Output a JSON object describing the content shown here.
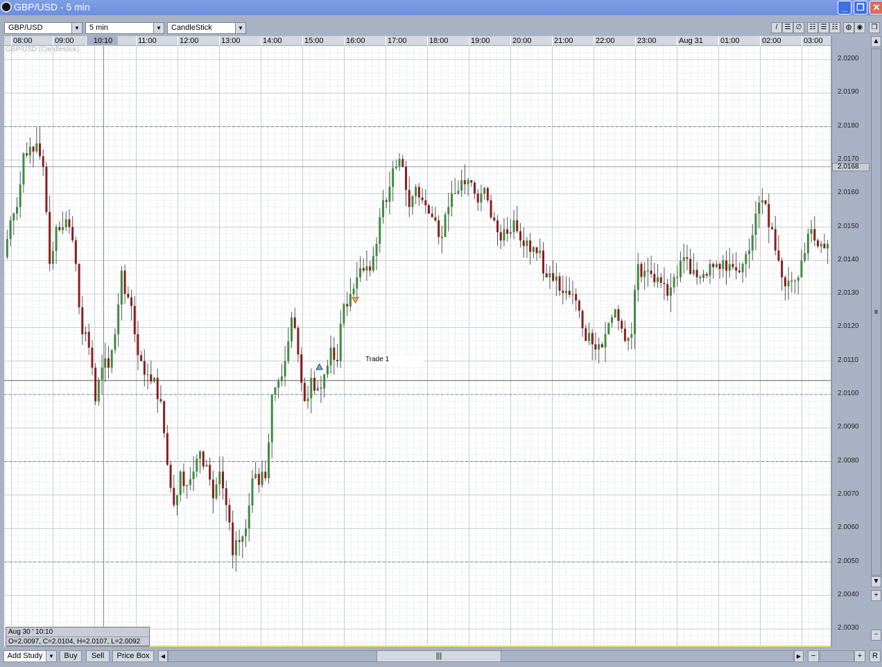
{
  "window": {
    "title": "GBP/USD - 5 min"
  },
  "toolbar": {
    "symbol": "GBP/USD",
    "interval": "5 min",
    "chart_type": "CandleStick"
  },
  "chart": {
    "name": "GBP/USD (Candlestick)",
    "crosshair_time": "10:10",
    "current_price": "2.0168",
    "trade_label": "Trade 1"
  },
  "info": {
    "date": "Aug 30 ' 10:10",
    "ohlc": "O=2.0097, C=2.0104, H=2.0107, L=2.0092"
  },
  "bottom": {
    "add_study": "Add Study",
    "buy": "Buy",
    "sell": "Sell",
    "price_box": "Price Box",
    "reset": "R"
  },
  "colors": {
    "up": "#3d8c3d",
    "down": "#8c1c1c",
    "title": "#7396e4"
  },
  "chart_data": {
    "type": "candlestick",
    "title": "GBP/USD (Candlestick)",
    "interval": "5 min",
    "time_labels": [
      "08:00",
      "09:00",
      "10:00",
      "11:00",
      "12:00",
      "13:00",
      "14:00",
      "15:00",
      "16:00",
      "17:00",
      "18:00",
      "19:00",
      "20:00",
      "21:00",
      "22:00",
      "23:00",
      "Aug 31",
      "01:00",
      "02:00",
      "03:00"
    ],
    "price_ticks": [
      "2.0200",
      "2.0190",
      "2.0180",
      "2.0170",
      "2.0160",
      "2.0150",
      "2.0140",
      "2.0130",
      "2.0120",
      "2.0110",
      "2.0100",
      "2.0090",
      "2.0080",
      "2.0070",
      "2.0060",
      "2.0050",
      "2.0040",
      "2.0030"
    ],
    "ylim": [
      2.003,
      2.02
    ],
    "hlines_dashed": [
      2.018,
      2.01,
      2.008,
      2.005
    ],
    "closes": [
      2.0141,
      2.0152,
      2.0156,
      2.0172,
      2.0174,
      2.0175,
      2.0168,
      2.0139,
      2.015,
      2.015,
      2.015,
      2.0139,
      2.0118,
      2.0114,
      2.0098,
      2.0108,
      2.0108,
      2.0118,
      2.0137,
      2.0129,
      2.0118,
      2.011,
      2.0106,
      2.0105,
      2.0098,
      2.0079,
      2.0067,
      2.0077,
      2.0073,
      2.0077,
      2.0083,
      2.0079,
      2.0069,
      2.0077,
      2.0067,
      2.0052,
      2.0056,
      2.006,
      2.0075,
      2.0073,
      2.0075,
      2.01,
      2.0104,
      2.011,
      2.0123,
      2.0112,
      2.0098,
      2.0105,
      2.0102,
      2.0106,
      2.0114,
      2.011,
      2.0127,
      2.013,
      2.0135,
      2.0137,
      2.0137,
      2.0145,
      2.0158,
      2.0162,
      2.0168,
      2.0168,
      2.0156,
      2.0162,
      2.0158,
      2.0154,
      2.0152,
      2.0147,
      2.0156,
      2.016,
      2.0164,
      2.0164,
      2.016,
      2.016,
      2.0158,
      2.0152,
      2.0146,
      2.0148,
      2.0152,
      2.0146,
      2.0146,
      2.0144,
      2.0143,
      2.0135,
      2.0134,
      2.0131,
      2.0131,
      2.013,
      2.0125,
      2.0116,
      2.0115,
      2.0115,
      2.0118,
      2.0123,
      2.0122,
      2.0116,
      2.0118,
      2.0139,
      2.0137,
      2.0136,
      2.0135,
      2.0133,
      2.0132,
      2.0135,
      2.0141,
      2.0136,
      2.0135,
      2.0136,
      2.0139,
      2.0139,
      2.014,
      2.0139,
      2.0137,
      2.0139,
      2.0143,
      2.0154,
      2.0158,
      2.015,
      2.0143,
      2.0135,
      2.0134,
      2.0134,
      2.014,
      2.0148,
      2.0146,
      2.0145,
      2.0145
    ]
  }
}
